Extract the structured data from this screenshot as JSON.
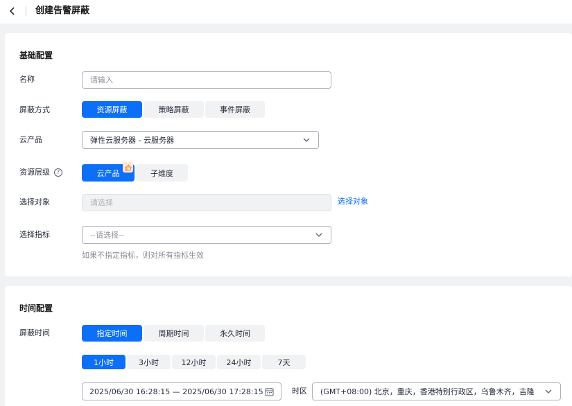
{
  "page": {
    "title": "创建告警屏蔽"
  },
  "basic": {
    "section_title": "基础配置",
    "name": {
      "label": "名称",
      "placeholder": "请输入"
    },
    "mask_type": {
      "label": "屏蔽方式",
      "options": [
        "资源屏蔽",
        "策略屏蔽",
        "事件屏蔽"
      ],
      "selected": "资源屏蔽"
    },
    "cloud_product": {
      "label": "云产品",
      "value": "弹性云服务器 - 云服务器"
    },
    "resource_level": {
      "label": "资源层级",
      "options": [
        "云产品",
        "子维度"
      ],
      "selected": "云产品"
    },
    "select_object": {
      "label": "选择对象",
      "placeholder": "请选择",
      "link": "选择对象"
    },
    "select_metric": {
      "label": "选择指标",
      "placeholder": "--请选择--",
      "hint": "如果不指定指标，则对所有指标生效"
    }
  },
  "time": {
    "section_title": "时间配置",
    "mask_time": {
      "label": "屏蔽时间",
      "options": [
        "指定时间",
        "周期时间",
        "永久时间"
      ],
      "selected": "指定时间"
    },
    "durations": {
      "options": [
        "1小时",
        "3小时",
        "12小时",
        "24小时",
        "7天"
      ],
      "selected": "1小时"
    },
    "range": {
      "value": "2025/06/30  16:28:15  —  2025/06/30  17:28:15"
    },
    "timezone": {
      "label": "时区",
      "value": "(GMT+08:00) 北京，重庆，香港特别行政区，乌鲁木齐，吉隆..."
    }
  },
  "colors": {
    "primary": "#0d6ef6",
    "link": "#0a6bf2",
    "page_bg": "#f1f2f3"
  }
}
